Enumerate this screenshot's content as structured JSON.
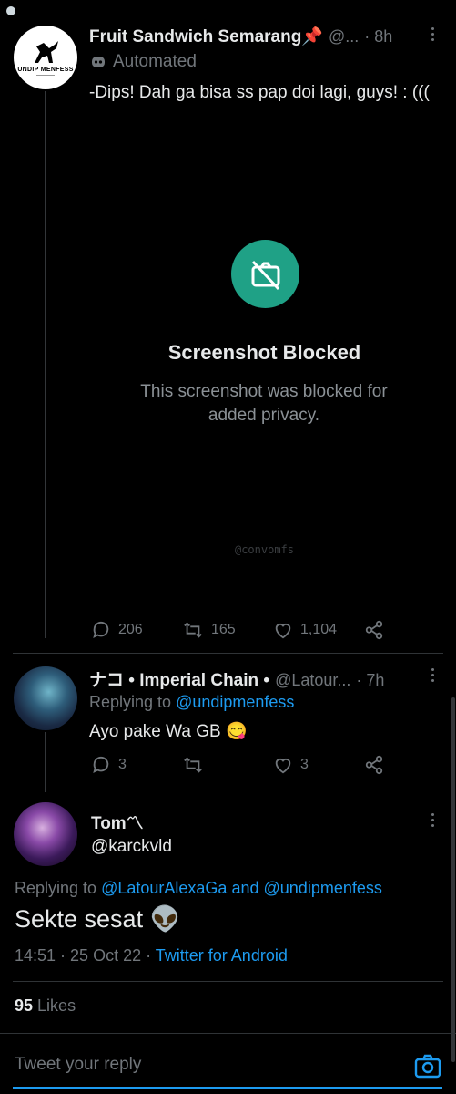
{
  "tweet1": {
    "author": "Fruit Sandwich Semarang📌",
    "handle": "@...",
    "time": "· 8h",
    "automated_label": "Automated",
    "text": "-Dips! Dah ga bisa ss pap doi lagi, guys! : (((",
    "avatar_text": "UNDIP MENFESS",
    "blocked_title": "Screenshot Blocked",
    "blocked_desc": "This screenshot was blocked for added privacy.",
    "watermark": "@convomfs",
    "replies": "206",
    "retweets": "165",
    "likes": "1,104"
  },
  "tweet2": {
    "author": "ナコ • Imperial Chain •",
    "handle": "@Latour...",
    "time": "· 7h",
    "replying_prefix": "Replying to",
    "replying_to": "@undipmenfess",
    "text": "Ayo pake Wa GB 😋",
    "replies": "3",
    "likes": "3"
  },
  "tweet3": {
    "author": "Tom〽",
    "handle": "@karckvld",
    "replying_prefix": "Replying to",
    "replying_user1": "@LatourAlexaGa",
    "replying_and": "and",
    "replying_user2": "@undipmenfess",
    "text": "Sekte sesat 👽",
    "timestamp": "14:51 · 25 Oct 22 ·",
    "client": "Twitter for Android",
    "likes_count": "95",
    "likes_label": "Likes"
  },
  "reply_bar": {
    "placeholder": "Tweet your reply"
  },
  "colors": {
    "accent": "#1d9bf0",
    "blocked_icon_bg": "#1fa186",
    "background": "#000000"
  }
}
